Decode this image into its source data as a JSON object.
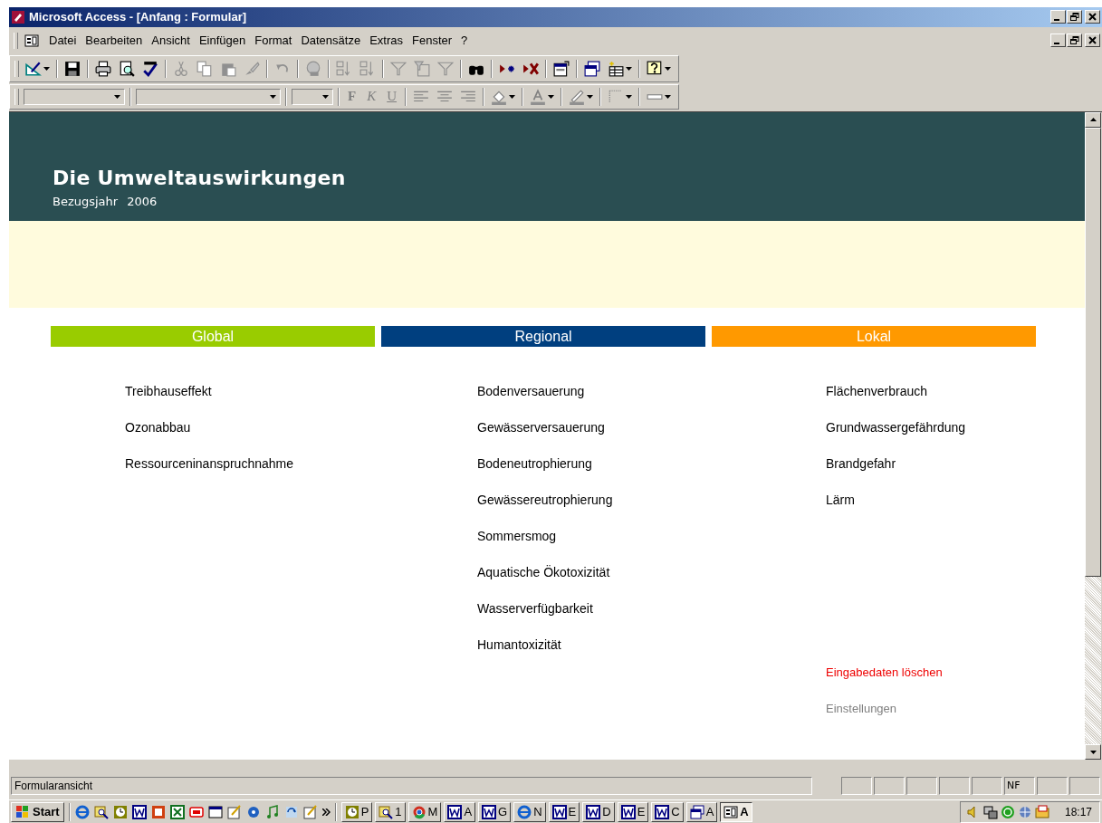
{
  "window": {
    "title": "Microsoft Access - [Anfang : Formular]"
  },
  "menu": [
    "Datei",
    "Bearbeiten",
    "Ansicht",
    "Einfügen",
    "Format",
    "Datensätze",
    "Extras",
    "Fenster",
    "?"
  ],
  "format_toolbar": {
    "text_buttons": [
      {
        "label": "F",
        "kind": "bold"
      },
      {
        "label": "K",
        "kind": "italic"
      },
      {
        "label": "U",
        "kind": "underline"
      }
    ]
  },
  "form": {
    "title": "Die Umweltauswirkungen",
    "year_label": "Bezugsjahr",
    "year": "2006",
    "columns": [
      {
        "heading": "Global",
        "color": "#99cc00",
        "items": [
          "Treibhauseffekt",
          "Ozonabbau",
          "Ressourceninanspruchnahme"
        ]
      },
      {
        "heading": "Regional",
        "color": "#003f7f",
        "items": [
          "Bodenversauerung",
          "Gewässerversauerung",
          "Bodeneutrophierung",
          "Gewässereutrophierung",
          "Sommersmog",
          "Aquatische Ökotoxizität",
          "Wasserverfügbarkeit",
          "Humantoxizität"
        ]
      },
      {
        "heading": "Lokal",
        "color": "#ff9900",
        "items": [
          "Flächenverbrauch",
          "Grundwassergefährdung",
          "Brandgefahr",
          "Lärm"
        ]
      }
    ],
    "links": [
      {
        "label": "Eingabedaten löschen",
        "kind": "danger"
      },
      {
        "label": "Einstellungen",
        "kind": "muted"
      }
    ]
  },
  "status_bar": {
    "text": "Formularansicht",
    "indicator": "NF"
  },
  "taskbar": {
    "start": "Start",
    "tasks": [
      {
        "label": "P",
        "selected": false
      },
      {
        "label": "1",
        "selected": false
      },
      {
        "label": "M",
        "selected": false
      },
      {
        "label": "A",
        "selected": false
      },
      {
        "label": "G",
        "selected": false
      },
      {
        "label": "N",
        "selected": false
      },
      {
        "label": "E",
        "selected": false
      },
      {
        "label": "D",
        "selected": false
      },
      {
        "label": "E",
        "selected": false
      },
      {
        "label": "C",
        "selected": false
      },
      {
        "label": "A",
        "selected": false
      },
      {
        "label": "A",
        "selected": true
      }
    ],
    "clock": "18:17"
  }
}
